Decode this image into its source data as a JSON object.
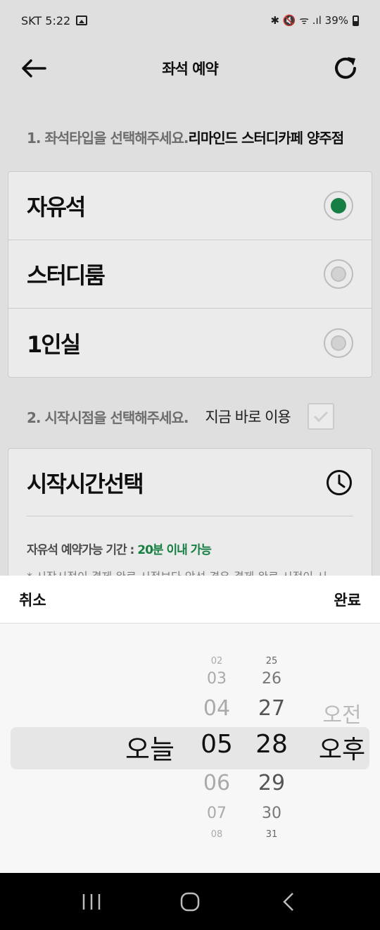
{
  "status_bar": {
    "carrier_time": "SKT 5:22",
    "indicators": "✱ 🔇 ᯤ .ıl 39%",
    "battery_icon": "battery-icon",
    "gallery_icon": "image-icon"
  },
  "header": {
    "title": "좌석 예약",
    "back_icon": "arrow-left-icon",
    "refresh_icon": "refresh-icon"
  },
  "section1": {
    "label": "1. 좌석타입을 선택해주세요.",
    "store_name": "리마인드 스터디카페 양주점"
  },
  "seat_types": [
    {
      "label": "자유석",
      "selected": true
    },
    {
      "label": "스터디룸",
      "selected": false
    },
    {
      "label": "1인실",
      "selected": false
    }
  ],
  "section2": {
    "label": "2. 시작시점을 선택해주세요.",
    "now_label": "지금 바로 이용"
  },
  "start_time": {
    "title": "시작시간선택",
    "clock_icon": "clock-icon",
    "available_prefix": "자유석 예약가능 기간 : ",
    "available_value": "20분 이내 가능",
    "notice": "* 시작시점이 결제 완료 시점보다 앞선 경우 결제 완료 시점이 시"
  },
  "picker": {
    "cancel": "취소",
    "done": "완료",
    "day": [
      "오늘"
    ],
    "hours": [
      "02",
      "03",
      "04",
      "05",
      "06",
      "07",
      "08"
    ],
    "minutes": [
      "25",
      "26",
      "27",
      "28",
      "29",
      "30",
      "31"
    ],
    "ampm": [
      "오전",
      "오후"
    ],
    "selected": {
      "day": "오늘",
      "hour": "05",
      "minute": "28",
      "ampm": "오후"
    }
  },
  "colors": {
    "accent_green": "#1b8a4a",
    "nav_background": "#000000"
  }
}
